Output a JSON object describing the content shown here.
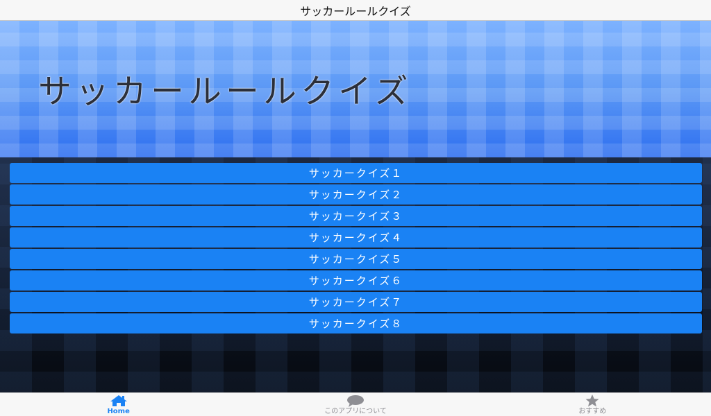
{
  "navbar": {
    "title": "サッカールールクイズ"
  },
  "banner": {
    "title": "サッカールールクイズ"
  },
  "quizzes": [
    {
      "label": "サッカークイズ１"
    },
    {
      "label": "サッカークイズ２"
    },
    {
      "label": "サッカークイズ３"
    },
    {
      "label": "サッカークイズ４"
    },
    {
      "label": "サッカークイズ５"
    },
    {
      "label": "サッカークイズ６"
    },
    {
      "label": "サッカークイズ７"
    },
    {
      "label": "サッカークイズ８"
    }
  ],
  "tabbar": {
    "tabs": [
      {
        "label": "Home",
        "icon": "house-icon",
        "active": true
      },
      {
        "label": "このアプリについて",
        "icon": "speech-bubble-icon",
        "active": false
      },
      {
        "label": "おすすめ",
        "icon": "star-icon",
        "active": false
      }
    ]
  },
  "colors": {
    "accent": "#1a82f4",
    "inactive": "#8e8e93",
    "banner_blue": "#4f8cf0"
  }
}
